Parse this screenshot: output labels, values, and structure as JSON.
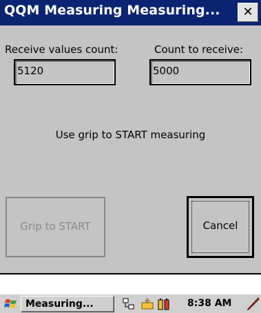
{
  "window": {
    "title": "QQM Measuring Measuring...",
    "close_icon": "close-icon",
    "close_glyph": "✕"
  },
  "form": {
    "receive_label": "Receive values count:",
    "receive_value": "5120",
    "count_label": "Count to receive:",
    "count_value": "5000",
    "instruction": "Use grip to START measuring",
    "grip_button": "Grip to START",
    "cancel_button": "Cancel"
  },
  "taskbar": {
    "start_icon": "windows-flag-icon",
    "task_label": "Measuring...",
    "tray_icons": [
      "network-icon",
      "folder-icon",
      "battery-icon"
    ],
    "clock": "8:38 AM",
    "pen_icon": "pen-icon"
  },
  "colors": {
    "titlebar": "#0a2473",
    "client": "#c4c4c4",
    "taskbar": "#d0d0d0"
  }
}
